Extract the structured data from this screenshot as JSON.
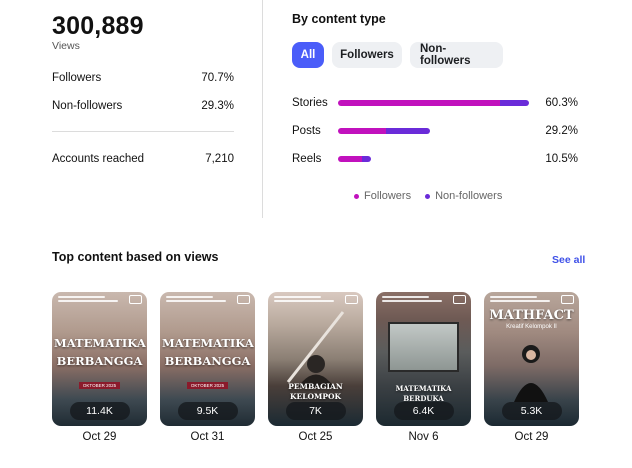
{
  "summary": {
    "views": "300,889",
    "views_label": "Views",
    "followers_label": "Followers",
    "followers_pct": "70.7%",
    "nonfollowers_label": "Non-followers",
    "nonfollowers_pct": "29.3%",
    "reached_label": "Accounts reached",
    "reached_value": "7,210"
  },
  "content_type": {
    "title": "By content type",
    "filters": [
      "All",
      "Followers",
      "Non-followers"
    ],
    "active_filter": "All",
    "rows": [
      {
        "label": "Stories",
        "pct_text": "60.3%",
        "total": 60.3,
        "followers_share": 0.85
      },
      {
        "label": "Posts",
        "pct_text": "29.2%",
        "total": 29.2,
        "followers_share": 0.52
      },
      {
        "label": "Reels",
        "pct_text": "10.5%",
        "total": 10.5,
        "followers_share": 0.72
      }
    ],
    "legend": [
      {
        "label": "Followers",
        "color": "#c111bd"
      },
      {
        "label": "Non-followers",
        "color": "#6a2bd9"
      }
    ]
  },
  "top_content": {
    "title": "Top content based on views",
    "see_all": "See all",
    "cards": [
      {
        "headline": "MATEMATIKA BERBANGGA",
        "tag": "OKTOBER 2025",
        "views": "11.4K",
        "date": "Oct 29",
        "style": "a"
      },
      {
        "headline": "MATEMATIKA BERBANGGA",
        "tag": "OKTOBER 2025",
        "views": "9.5K",
        "date": "Oct 31",
        "style": "a"
      },
      {
        "headline": "PEMBAGIAN KELOMPOK",
        "tag": "",
        "views": "7K",
        "date": "Oct 25",
        "style": "b"
      },
      {
        "headline": "MATEMATIKA BERDUKA",
        "tag": "",
        "views": "6.4K",
        "date": "Nov 6",
        "style": "c"
      },
      {
        "headline": "MATHFACT",
        "tag": "Kreatif Kelompok II",
        "views": "5.3K",
        "date": "Oct 29",
        "style": "d"
      }
    ]
  },
  "colors": {
    "accent": "#4a5df9",
    "followers": "#c111bd",
    "nonfollowers": "#6a2bd9",
    "link": "#3f51e8"
  }
}
